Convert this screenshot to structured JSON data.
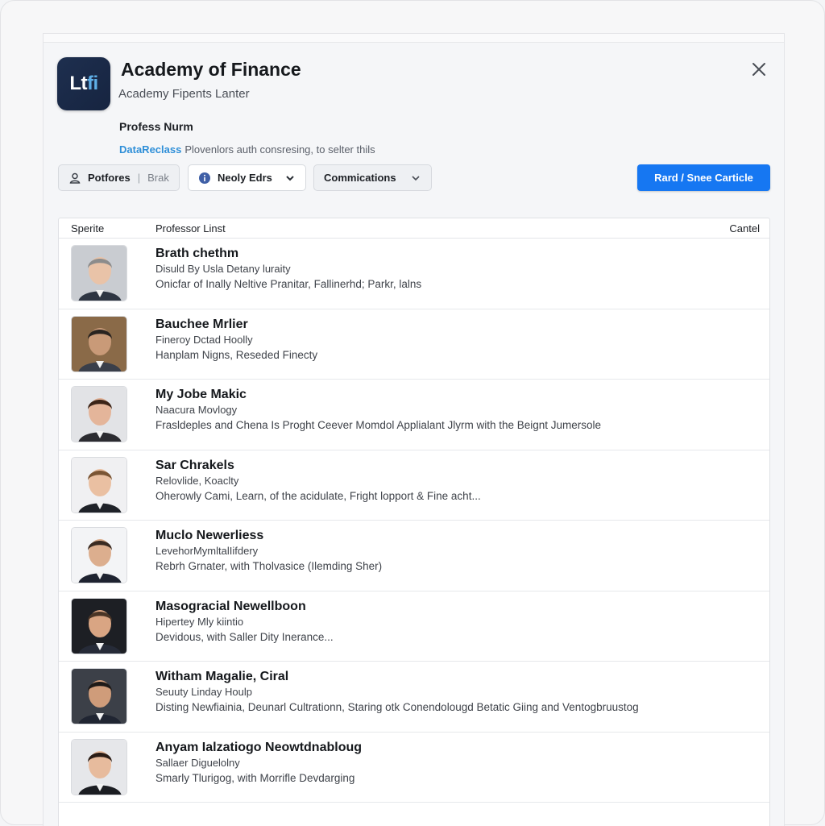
{
  "app": {
    "logo_text": "Ltfi",
    "title": "Academy of Finance",
    "subtitle": "Academy Fipents Lanter"
  },
  "section": {
    "label": "Profess Nurm",
    "hint_link": "DataReclass",
    "hint_text": "Plovenlors auth consresing, to selter thils"
  },
  "toolbar": {
    "profiles_label": "Potfores",
    "profiles_secondary": "Brak",
    "newly_label": "Neoly Edrs",
    "comm_label": "Commications",
    "primary_label": "Rard / Snee Carticle"
  },
  "list": {
    "header": {
      "sprite": "Sperite",
      "title": "Professor Linst",
      "cancel": "Cantel"
    },
    "rows": [
      {
        "name": "Brath chethm",
        "role": "Disuld By Usla Detany luraity",
        "desc": "Onicfar of Inally Neltive Pranitar, Fallinerhd; Parkr, lalns",
        "skin": "#e9c3a8",
        "hair": "#8c8c8c",
        "suit": "#2e3542",
        "bg": "#c9ccd1"
      },
      {
        "name": "Bauchee Mrlier",
        "role": "Fineroy Dctad Hoolly",
        "desc": "Hanplam Nigns, Reseded Finecty",
        "skin": "#c99a78",
        "hair": "#2a2420",
        "suit": "#3a3f4a",
        "bg": "#8a6a48"
      },
      {
        "name": "My Jobe Makic",
        "role": "Naacura Movlogy",
        "desc": "Frasldeples and Chena Is Proght Ceever Momdol Applialant Jlyrm with the Beignt Jumersole",
        "skin": "#e4b59a",
        "hair": "#3b2418",
        "suit": "#2b2b30",
        "bg": "#e2e3e6"
      },
      {
        "name": "Sar Chrakels",
        "role": "Relovlide, Koaclty",
        "desc": "Oherowly Cami, Learn, of the acidulate, Fright lopport & Fine acht...",
        "skin": "#eac0a2",
        "hair": "#7a5534",
        "suit": "#1f2228",
        "bg": "#f0f0f2"
      },
      {
        "name": "Muclo Newerliess",
        "role": "LevehorMymltalIifdery",
        "desc": "Rebrh Grnater, with Tholvasice (Ilemding Sher)",
        "skin": "#dcae8e",
        "hair": "#3a2b22",
        "suit": "#1e2330",
        "bg": "#f3f4f6"
      },
      {
        "name": "Masogracial Newellboon",
        "role": "Hipertey Mly kiintio",
        "desc": "Devidous, with Saller Dity Inerance...",
        "skin": "#d9a583",
        "hair": "#4a3526",
        "suit": "#262b38",
        "bg": "#1d1f24"
      },
      {
        "name": "Witham Magalie, Ciral",
        "role": "Seuuty Linday Houlp",
        "desc": "Disting Newfiainia, Deunarl Cultrationn, Staring otk Conendolougd Betatic Giing and Ventogbruustog",
        "skin": "#cf9c7a",
        "hair": "#1e1a18",
        "suit": "#202532",
        "bg": "#3c4048"
      },
      {
        "name": "Anyam Ialzatiogo Neowtdnabloug",
        "role": "Sallaer Diguelolny",
        "desc": "Smarly Tlurigog, with Morrifle Devdarging",
        "skin": "#e7bb9d",
        "hair": "#2b1d16",
        "suit": "#1b1d22",
        "bg": "#e6e7ea"
      }
    ]
  },
  "colors": {
    "primary": "#1677f2",
    "link": "#2f8fd8",
    "logo_bg": "#1e2f4f"
  },
  "icons": {
    "close": "close-icon",
    "profiles": "person-badge-icon",
    "newly": "info-circle-icon",
    "chevron": "chevron-down-icon"
  }
}
